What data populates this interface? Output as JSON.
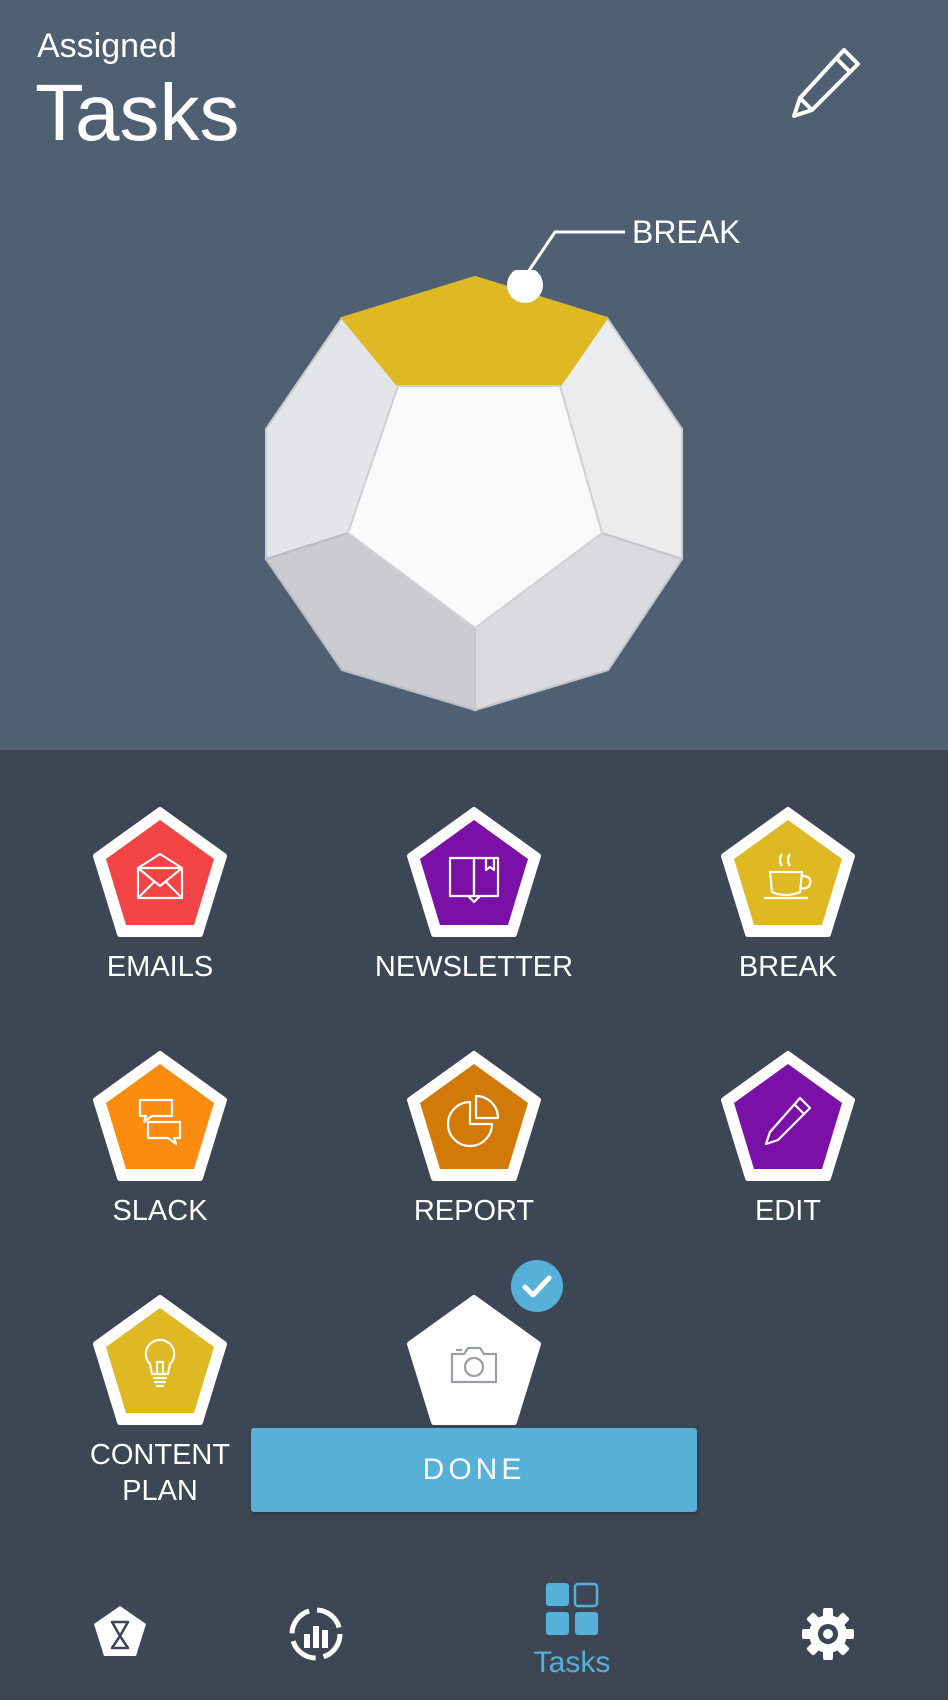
{
  "header": {
    "subtitle": "Assigned",
    "title": "Tasks",
    "edit_icon": "pencil-icon"
  },
  "selection": {
    "callout_label": "BREAK",
    "highlight_color": "#dfb923"
  },
  "tasks": [
    {
      "label": "EMAILS",
      "icon": "envelope-icon",
      "color": "#f24444"
    },
    {
      "label": "NEWSLETTER",
      "icon": "book-icon",
      "color": "#7b10a6"
    },
    {
      "label": "BREAK",
      "icon": "coffee-cup-icon",
      "color": "#dfb923"
    },
    {
      "label": "SLACK",
      "icon": "chat-bubbles-icon",
      "color": "#fb8c0f"
    },
    {
      "label": "REPORT",
      "icon": "pie-chart-icon",
      "color": "#d17a08"
    },
    {
      "label": "EDIT",
      "icon": "pencil-icon",
      "color": "#7b10a6"
    },
    {
      "label": "CONTENT PLAN",
      "icon": "lightbulb-icon",
      "color": "#dfb923"
    },
    {
      "label": "",
      "icon": "camera-icon",
      "color": "#ffffff",
      "checked": true
    }
  ],
  "done_button": {
    "label": "DONE",
    "color": "#56b0d8"
  },
  "bottom_nav": {
    "items": [
      {
        "icon": "hourglass-icon",
        "label": ""
      },
      {
        "icon": "stats-icon",
        "label": ""
      },
      {
        "icon": "grid-icon",
        "label": "Tasks",
        "active": true
      },
      {
        "icon": "gear-icon",
        "label": ""
      }
    ],
    "active_color": "#56b0d8"
  }
}
